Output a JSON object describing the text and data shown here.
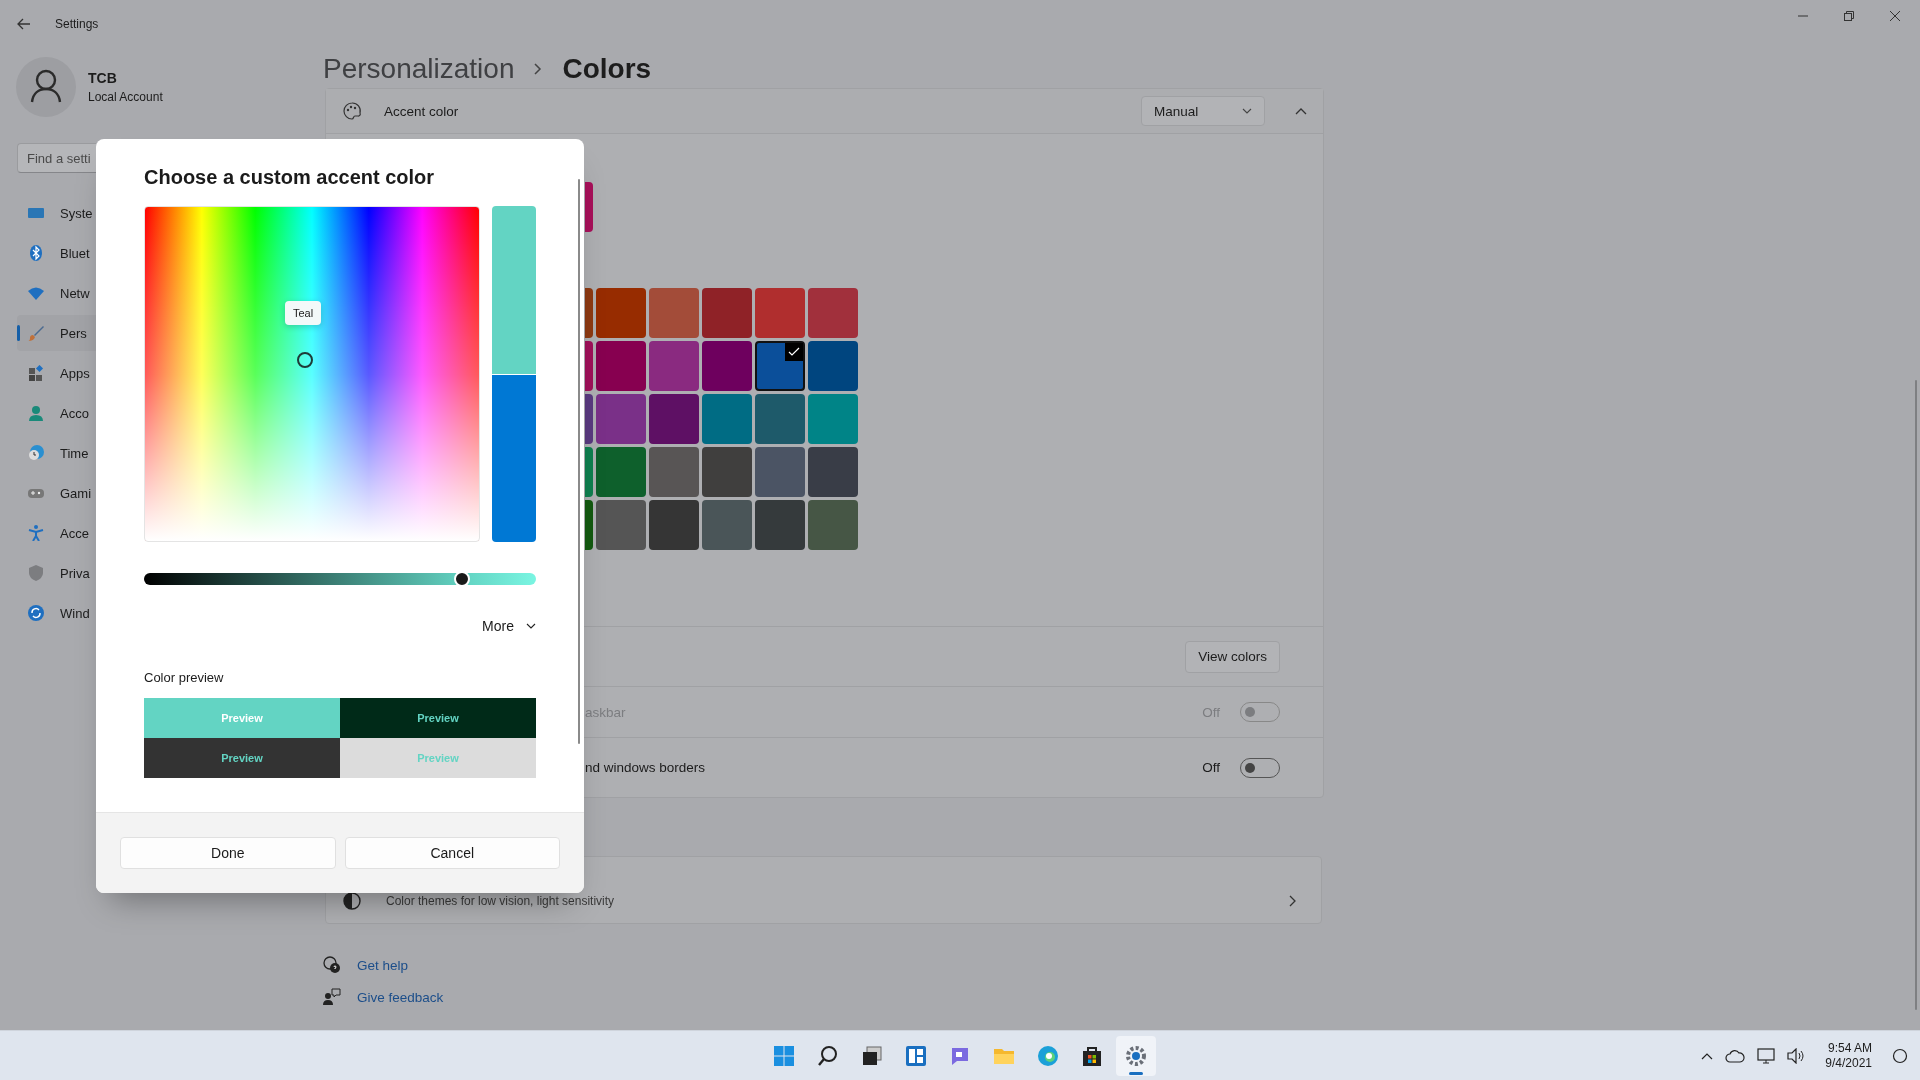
{
  "window": {
    "title": "Settings"
  },
  "user": {
    "name": "TCB",
    "account": "Local Account"
  },
  "search": {
    "placeholder": "Find a setti"
  },
  "nav": [
    {
      "label": "Syste",
      "selected": false
    },
    {
      "label": "Bluet",
      "selected": false
    },
    {
      "label": "Netw",
      "selected": false
    },
    {
      "label": "Pers",
      "selected": true
    },
    {
      "label": "Apps",
      "selected": false
    },
    {
      "label": "Acco",
      "selected": false
    },
    {
      "label": "Time",
      "selected": false
    },
    {
      "label": "Gami",
      "selected": false
    },
    {
      "label": "Acce",
      "selected": false
    },
    {
      "label": "Priva",
      "selected": false
    },
    {
      "label": "Wind",
      "selected": false
    }
  ],
  "breadcrumb": [
    "Personalization",
    "Colors"
  ],
  "accent": {
    "label": "Accent color",
    "mode": "Manual",
    "expanded": true,
    "recent": [
      {
        "color": "#a8105a"
      }
    ],
    "swatches": [
      [
        {
          "color": "#8e3a12",
          "selected": false
        },
        {
          "color": "#972c00",
          "selected": false
        },
        {
          "color": "#a34c39",
          "selected": false
        },
        {
          "color": "#8f2227",
          "selected": false
        },
        {
          "color": "#b02e2e",
          "selected": false
        },
        {
          "color": "#a1303c",
          "selected": false
        }
      ],
      [
        {
          "color": "#a0105a",
          "selected": false
        },
        {
          "color": "#870050",
          "selected": false
        },
        {
          "color": "#8a2a80",
          "selected": false
        },
        {
          "color": "#6e005e",
          "selected": false
        },
        {
          "color": "#0b4f9a",
          "selected": true
        },
        {
          "color": "#00457f",
          "selected": false
        }
      ],
      [
        {
          "color": "#5a3a80",
          "selected": false
        },
        {
          "color": "#7a3088",
          "selected": false
        },
        {
          "color": "#5e1064",
          "selected": false
        },
        {
          "color": "#006c84",
          "selected": false
        },
        {
          "color": "#1e5a6a",
          "selected": false
        },
        {
          "color": "#008487",
          "selected": false
        }
      ],
      [
        {
          "color": "#0f8050",
          "selected": false
        },
        {
          "color": "#0e602c",
          "selected": false
        },
        {
          "color": "#585555",
          "selected": false
        },
        {
          "color": "#403f3e",
          "selected": false
        },
        {
          "color": "#4b5464",
          "selected": false
        },
        {
          "color": "#393d47",
          "selected": false
        }
      ],
      [
        {
          "color": "#135a10",
          "selected": false
        },
        {
          "color": "#555555",
          "selected": false
        },
        {
          "color": "#353535",
          "selected": false
        },
        {
          "color": "#4a5558",
          "selected": false
        },
        {
          "color": "#353a3c",
          "selected": false
        },
        {
          "color": "#465645",
          "selected": false
        }
      ]
    ]
  },
  "rows": [
    {
      "kind": "button",
      "button": "View colors"
    },
    {
      "kind": "toggle",
      "label": "askbar",
      "state": "Off",
      "on": false,
      "disabled": true
    },
    {
      "kind": "toggle",
      "label": "nd windows borders",
      "state": "Off",
      "on": false,
      "disabled": false
    }
  ],
  "contrast": {
    "description": "Color themes for low vision, light sensitivity"
  },
  "links": [
    "Get help",
    "Give feedback"
  ],
  "dialog": {
    "title": "Choose a custom accent color",
    "tooltip": "Teal",
    "slider": {
      "level": 0.81
    },
    "more": "More",
    "preview_label": "Color preview",
    "previews": [
      "Preview",
      "Preview",
      "Preview",
      "Preview"
    ],
    "buttons": [
      "Done",
      "Cancel"
    ]
  },
  "taskbar": {
    "apps": [
      {
        "selected": false
      },
      {
        "selected": false
      },
      {
        "selected": false
      },
      {
        "selected": false
      },
      {
        "selected": false
      },
      {
        "selected": false
      },
      {
        "selected": false
      },
      {
        "selected": false
      },
      {
        "selected": true
      }
    ]
  },
  "clock": {
    "time": "9:54 AM",
    "date": "9/4/2021"
  }
}
